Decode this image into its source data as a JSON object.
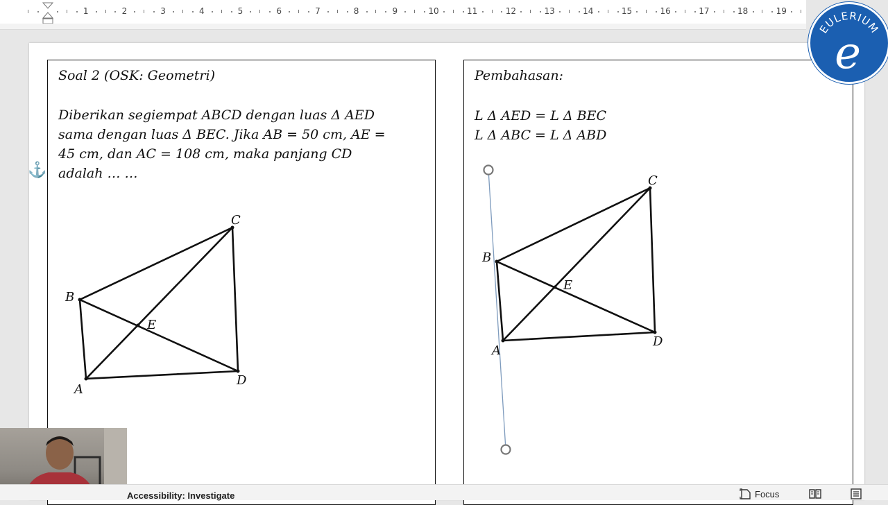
{
  "ruler": {
    "numbers": [
      "1",
      "2",
      "3",
      "4",
      "5",
      "6",
      "7",
      "8",
      "9",
      "10",
      "11",
      "12",
      "13",
      "14",
      "15",
      "16",
      "17",
      "18",
      "19"
    ]
  },
  "logo": {
    "text": "EULERIUM",
    "letter": "e"
  },
  "problem": {
    "title": "Soal 2 (OSK: Geometri)",
    "lines": [
      "Diberikan segiempat ABCD dengan luas Δ AED",
      "sama dengan luas Δ BEC. Jika AB = 50 cm, AE =",
      "45 cm, dan AC = 108 cm, maka panjang CD",
      "adalah … …"
    ],
    "figure_labels": {
      "A": "A",
      "B": "B",
      "C": "C",
      "D": "D",
      "E": "E"
    }
  },
  "solution": {
    "title": "Pembahasan:",
    "lines": [
      "L Δ AED = L Δ BEC",
      "L Δ ABC = L Δ ABD"
    ],
    "figure_labels": {
      "A": "A",
      "B": "B",
      "C": "C",
      "D": "D",
      "E": "E"
    }
  },
  "statusbar": {
    "accessibility": "Accessibility: Investigate",
    "focus_label": "Focus"
  },
  "colors": {
    "accent": "#1b5fb1",
    "anchor": "#3b8fd0",
    "line": "#111111"
  },
  "icons": [
    "indent-marker-icon",
    "anchor-icon",
    "focus-icon",
    "read-mode-icon",
    "print-layout-icon"
  ]
}
